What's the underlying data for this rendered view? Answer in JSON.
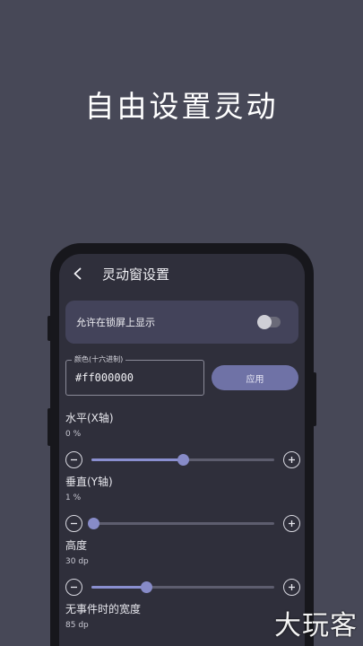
{
  "hero": {
    "title": "自由设置灵动"
  },
  "header": {
    "title": "灵动窗设置"
  },
  "lockscreen": {
    "label": "允许在锁屏上显示",
    "enabled": false
  },
  "color": {
    "label": "颜色(十六进制)",
    "value": "#ff000000",
    "apply_label": "应用"
  },
  "settings": [
    {
      "title": "水平(X轴)",
      "value": "0 %",
      "level": 0.5
    },
    {
      "title": "垂直(Y轴)",
      "value": "1 %",
      "level": 0.01
    },
    {
      "title": "高度",
      "value": "30 dp",
      "level": 0.3
    },
    {
      "title": "无事件时的宽度",
      "value": "85 dp"
    }
  ],
  "watermark": "大玩客",
  "colors": {
    "background": "#474857",
    "screen": "#2f2f3b",
    "card": "#43435a",
    "accent": "#6f72a6",
    "slider": "#878bc8"
  }
}
